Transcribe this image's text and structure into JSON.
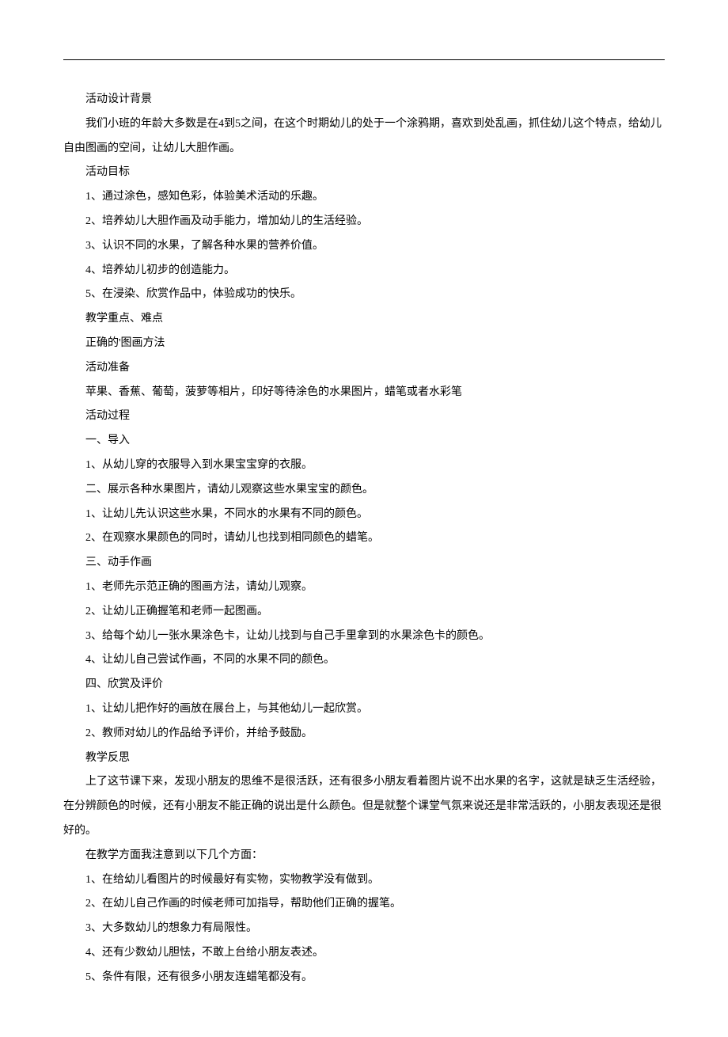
{
  "sections": {
    "background": {
      "heading": "活动设计背景",
      "body": "我们小班的年龄大多数是在4到5之间，在这个时期幼儿的处于一个涂鸦期，喜欢到处乱画，抓住幼儿这个特点，给幼儿自由图画的空间，让幼儿大胆作画。"
    },
    "goals": {
      "heading": "活动目标",
      "items": [
        "1、通过涂色，感知色彩，体验美术活动的乐趣。",
        "2、培养幼儿大胆作画及动手能力，增加幼儿的生活经验。",
        "3、认识不同的水果，了解各种水果的营养价值。",
        "4、培养幼儿初步的创造能力。",
        "5、在浸染、欣赏作品中，体验成功的快乐。"
      ]
    },
    "emphasis": {
      "heading": "教学重点、难点",
      "body": "正确的'图画方法"
    },
    "preparation": {
      "heading": "活动准备",
      "body": "苹果、香蕉、葡萄，菠萝等相片，印好等待涂色的水果图片，蜡笔或者水彩笔"
    },
    "process": {
      "heading": "活动过程",
      "part1": {
        "title": "一、导入",
        "items": [
          "1、从幼儿穿的衣服导入到水果宝宝穿的衣服。"
        ]
      },
      "part2": {
        "title": "二、展示各种水果图片，请幼儿观察这些水果宝宝的颜色。",
        "items": [
          "1、让幼儿先认识这些水果，不同水的水果有不同的颜色。",
          "2、在观察水果颜色的同时，请幼儿也找到相同颜色的蜡笔。"
        ]
      },
      "part3": {
        "title": "三、动手作画",
        "items": [
          "1、老师先示范正确的图画方法，请幼儿观察。",
          "2、让幼儿正确握笔和老师一起图画。",
          "3、给每个幼儿一张水果涂色卡，让幼儿找到与自己手里拿到的水果涂色卡的颜色。",
          "4、让幼儿自己尝试作画，不同的水果不同的颜色。"
        ]
      },
      "part4": {
        "title": "四、欣赏及评价",
        "items": [
          "1、让幼儿把作好的画放在展台上，与其他幼儿一起欣赏。",
          "2、教师对幼儿的作品给予评价，并给予鼓励。"
        ]
      }
    },
    "reflection": {
      "heading": "教学反思",
      "body1": "上了这节课下来，发现小朋友的思维不是很活跃，还有很多小朋友看着图片说不出水果的名字，这就是缺乏生活经验，在分辨颜色的时候，还有小朋友不能正确的说出是什么颜色。但是就整个课堂气氛来说还是非常活跃的，小朋友表现还是很好的。",
      "body2": "在教学方面我注意到以下几个方面：",
      "items": [
        "1、在给幼儿看图片的时候最好有实物，实物教学没有做到。",
        "2、在幼儿自己作画的时候老师可加指导，帮助他们正确的握笔。",
        "3、大多数幼儿的想象力有局限性。",
        "4、还有少数幼儿胆怯，不敢上台给小朋友表述。",
        "5、条件有限，还有很多小朋友连蜡笔都没有。"
      ]
    }
  }
}
